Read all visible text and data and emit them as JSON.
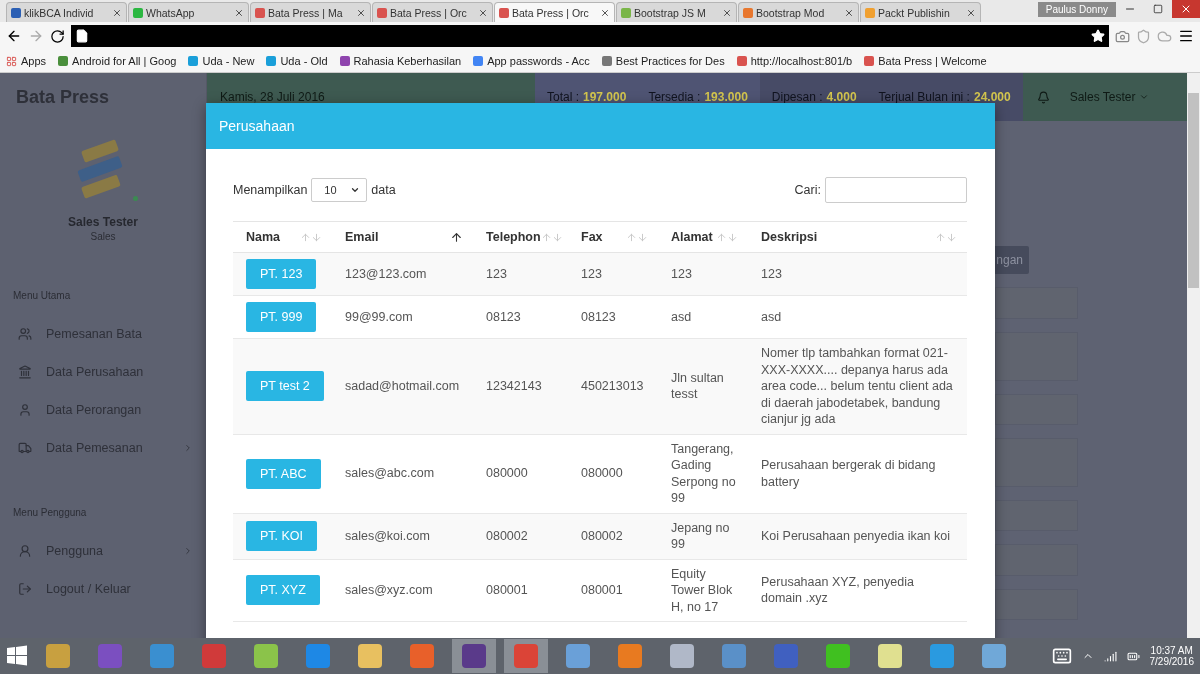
{
  "browser": {
    "tabs": [
      {
        "title": "klikBCA Individ",
        "selected": false
      },
      {
        "title": "WhatsApp",
        "selected": false
      },
      {
        "title": "Bata Press | Ma",
        "selected": false
      },
      {
        "title": "Bata Press | Orc",
        "selected": false
      },
      {
        "title": "Bata Press | Orc",
        "selected": true
      },
      {
        "title": "Bootstrap JS M",
        "selected": false
      },
      {
        "title": "Bootstrap Mod",
        "selected": false
      },
      {
        "title": "Packt Publishin",
        "selected": false
      }
    ],
    "profile": "Paulus Donny",
    "bookmarks": [
      "Apps",
      "Android for All | Goog",
      "Uda - New",
      "Uda - Old",
      "Rahasia Keberhasilan",
      "App passwords - Acc",
      "Best Practices for Des",
      "http://localhost:801/b",
      "Bata Press | Welcome"
    ]
  },
  "app": {
    "brand": "Bata Press",
    "date": "Kamis, 28 Juli 2016",
    "stats": [
      {
        "label": "Total :",
        "value": "197.000"
      },
      {
        "label": "Tersedia :",
        "value": "193.000"
      },
      {
        "label": "Dipesan :",
        "value": "4.000"
      },
      {
        "label": "Terjual Bulan ini :",
        "value": "24.000"
      }
    ],
    "user_menu": "Sales Tester",
    "profile": {
      "name": "Sales Tester",
      "role": "Sales",
      "online": true
    },
    "sections": [
      {
        "title": "Menu Utama",
        "items": [
          {
            "label": "Pemesanan Bata",
            "has_submenu": false
          },
          {
            "label": "Data Perusahaan",
            "has_submenu": false
          },
          {
            "label": "Data Perorangan",
            "has_submenu": false
          },
          {
            "label": "Data Pemesanan",
            "has_submenu": true
          }
        ]
      },
      {
        "title": "Menu Pengguna",
        "items": [
          {
            "label": "Pengguna",
            "has_submenu": true
          },
          {
            "label": "Logout / Keluar",
            "has_submenu": false
          }
        ]
      }
    ],
    "background_button": "ngan"
  },
  "modal": {
    "title": "Perusahaan",
    "length_label": "Menampilkan",
    "length_value": "10",
    "length_suffix": "data",
    "search_label": "Cari:",
    "columns": [
      {
        "label": "Nama",
        "sorted": false
      },
      {
        "label": "Email",
        "sorted": true
      },
      {
        "label": "Telephon",
        "sorted": false
      },
      {
        "label": "Fax",
        "sorted": false
      },
      {
        "label": "Alamat",
        "sorted": false
      },
      {
        "label": "Deskripsi",
        "sorted": false
      }
    ],
    "rows": [
      {
        "nama": "PT. 123",
        "email": "123@123.com",
        "telephon": "123",
        "fax": "123",
        "alamat": "123",
        "deskripsi": "123"
      },
      {
        "nama": "PT. 999",
        "email": "99@99.com",
        "telephon": "08123",
        "fax": "08123",
        "alamat": "asd",
        "deskripsi": "asd"
      },
      {
        "nama": "PT test 2",
        "email": "sadad@hotmail.com",
        "telephon": "12342143",
        "fax": "450213013",
        "alamat": "Jln sultan tesst",
        "deskripsi": "Nomer tlp tambahkan format 021-XXX-XXXX.... depanya harus ada area code... belum tentu client ada di daerah jabodetabek, bandung cianjur jg ada"
      },
      {
        "nama": "PT. ABC",
        "email": "sales@abc.com",
        "telephon": "080000",
        "fax": "080000",
        "alamat": "Tangerang, Gading Serpong no 99",
        "deskripsi": "Perusahaan bergerak di bidang battery"
      },
      {
        "nama": "PT. KOI",
        "email": "sales@koi.com",
        "telephon": "080002",
        "fax": "080002",
        "alamat": "Jepang no 99",
        "deskripsi": "Koi Perusahaan penyedia ikan koi"
      },
      {
        "nama": "PT. XYZ",
        "email": "sales@xyz.com",
        "telephon": "080001",
        "fax": "080001",
        "alamat": "Equity Tower Blok H, no 17",
        "deskripsi": "Perusahaan XYZ, penyedia domain .xyz"
      }
    ]
  },
  "taskbar": {
    "apps": [
      {
        "active": false
      },
      {
        "active": false
      },
      {
        "active": false
      },
      {
        "active": false
      },
      {
        "active": false
      },
      {
        "active": false
      },
      {
        "active": false
      },
      {
        "active": false
      },
      {
        "active": true
      },
      {
        "active": true
      },
      {
        "active": false
      },
      {
        "active": false
      },
      {
        "active": false
      },
      {
        "active": false
      },
      {
        "active": false
      },
      {
        "active": false
      },
      {
        "active": false
      },
      {
        "active": false
      },
      {
        "active": false
      }
    ],
    "time": "10:37 AM",
    "date": "7/29/2016"
  }
}
